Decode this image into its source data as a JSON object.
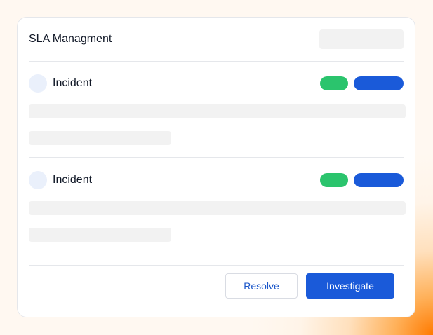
{
  "card": {
    "title": "SLA Managment"
  },
  "incidents": [
    {
      "title": "Incident",
      "tags": [
        {
          "color": "#2bc46d",
          "label": ""
        },
        {
          "color": "#1a5ad9",
          "label": ""
        }
      ]
    },
    {
      "title": "Incident",
      "tags": [
        {
          "color": "#2bc46d",
          "label": ""
        },
        {
          "color": "#1a5ad9",
          "label": ""
        }
      ]
    }
  ],
  "actions": {
    "resolve_label": "Resolve",
    "investigate_label": "Investigate"
  },
  "colors": {
    "primary": "#1a5ad9",
    "success": "#2bc46d",
    "skeleton": "#f2f2f2",
    "avatar": "#eaf0fb"
  }
}
